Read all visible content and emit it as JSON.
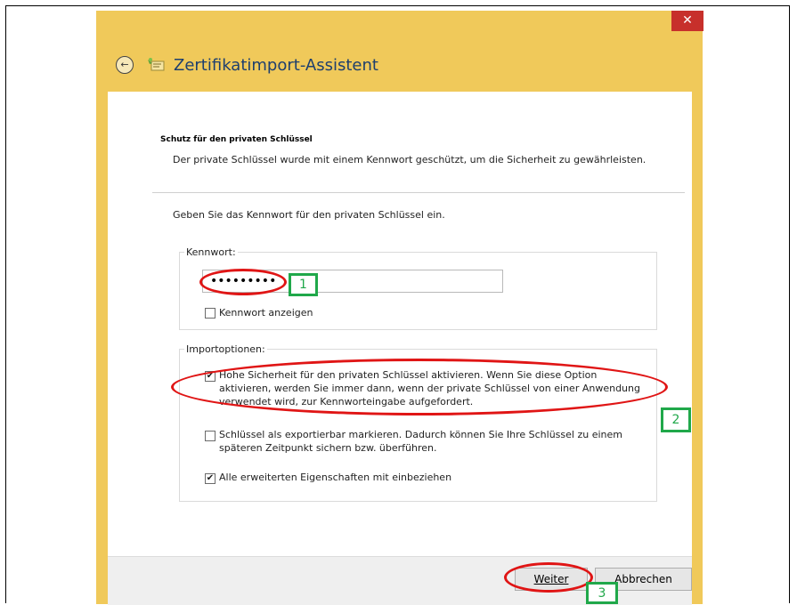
{
  "window": {
    "title": "Zertifikatimport-Assistent",
    "close_glyph": "✕",
    "back_glyph": "←"
  },
  "header": {
    "section_title": "Schutz für den privaten Schlüssel",
    "section_desc": "Der private Schlüssel wurde mit einem Kennwort geschützt, um die Sicherheit zu gewährleisten."
  },
  "main": {
    "prompt": "Geben Sie das Kennwort für den privaten Schlüssel ein.",
    "password_group_label": "Kennwort:",
    "password_value": "•••••••••",
    "show_password_label": "Kennwort anzeigen",
    "show_password_checked": false,
    "import_group_label": "Importoptionen:",
    "options": [
      {
        "label": "Hohe Sicherheit für den privaten Schlüssel aktivieren. Wenn Sie diese Option aktivieren, werden Sie immer dann, wenn der private Schlüssel von einer Anwendung verwendet wird, zur Kennworteingabe aufgefordert.",
        "checked": true
      },
      {
        "label": "Schlüssel als exportierbar markieren. Dadurch können Sie Ihre Schlüssel zu einem späteren Zeitpunkt sichern bzw. überführen.",
        "checked": false
      },
      {
        "label": "Alle erweiterten Eigenschaften mit einbeziehen",
        "checked": true
      }
    ],
    "check_glyph": "✔"
  },
  "footer": {
    "next_label": "Weiter",
    "cancel_label": "Abbrechen"
  },
  "annotations": {
    "marker_1": "1",
    "marker_2": "2",
    "marker_3": "3"
  },
  "colors": {
    "window_chrome": "#f0c95a",
    "close_button": "#c7302b",
    "title_text": "#1e3f6e",
    "highlight_ellipse": "#e01515",
    "marker_green": "#20a84a"
  }
}
